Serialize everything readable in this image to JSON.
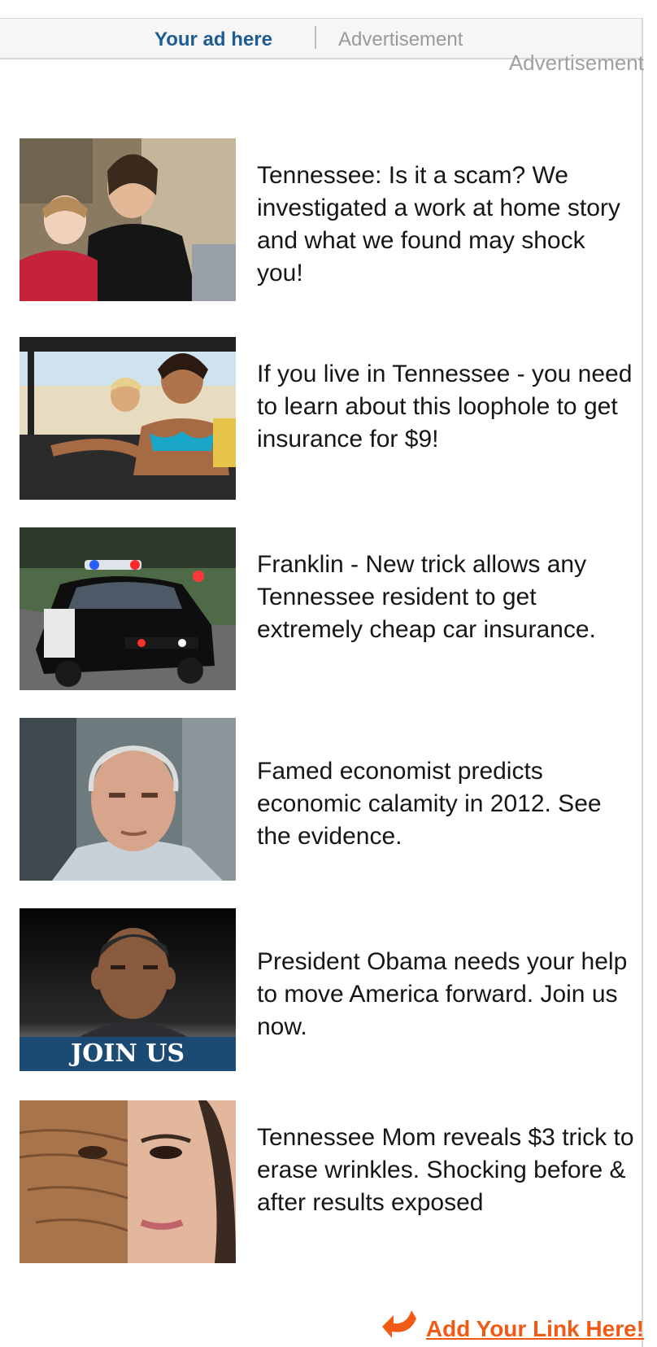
{
  "header": {
    "your_ad_here": "Your ad here",
    "advertisement": "Advertisement"
  },
  "corner_label": "Advertisement",
  "ads": [
    {
      "text": "Tennessee: Is it a scam? We investigated a work at home story and what we found may shock you!",
      "icon": "mother-daughter-laptop-photo"
    },
    {
      "text": "If you live in Tennessee - you need to learn about this loophole to get insurance for $9!",
      "icon": "women-in-jeep-photo"
    },
    {
      "text": "Franklin - New trick allows any Tennessee resident to get extremely cheap car insurance.",
      "icon": "police-car-photo"
    },
    {
      "text": "Famed economist predicts economic calamity in 2012. See the evidence.",
      "icon": "older-man-portrait-photo"
    },
    {
      "text": "President Obama needs your help to move America forward. Join us now.",
      "icon": "obama-join-us-photo",
      "overlay_text": "JOIN US"
    },
    {
      "text": "Tennessee Mom reveals $3 trick to erase wrinkles. Shocking before & after results exposed",
      "icon": "before-after-face-photo"
    }
  ],
  "footer": {
    "link_text": "Add Your Link Here!",
    "icon": "curved-arrow-icon"
  },
  "colors": {
    "brand_blue": "#1e5c92",
    "link_orange": "#f05a14",
    "muted_gray": "#9a9a9a"
  }
}
